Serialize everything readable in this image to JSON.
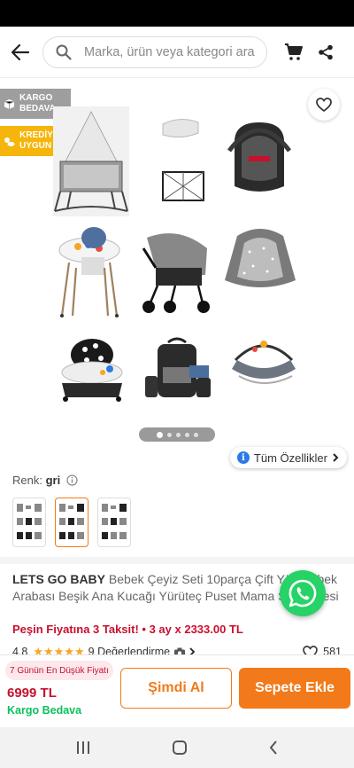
{
  "header": {
    "back_icon": "arrow-left-icon",
    "search_placeholder": "Marka, ürün veya kategori ara",
    "cart_icon": "cart-icon",
    "share_icon": "share-icon"
  },
  "gallery": {
    "badges": [
      {
        "line1": "KARGO",
        "line2": "BEDAVA",
        "color": "#9e9e9e",
        "icon": "box-icon"
      },
      {
        "line1": "KREDİYE",
        "line2": "UYGUN",
        "color": "#f5b50a",
        "icon": "coins-icon"
      }
    ],
    "favorite_icon": "heart-icon",
    "items": [
      "crib",
      "blanket",
      "car-seat",
      "mosquito-net",
      "high-chair",
      "stroller",
      "carrier-cover",
      "baby-walker",
      "diaper-bag",
      "bouncer"
    ],
    "page_dots": 5,
    "active_dot": 0,
    "all_features_label": "Tüm Özellikler"
  },
  "color": {
    "label": "Renk:",
    "value": "gri",
    "selected_index": 1,
    "options_count": 3
  },
  "product": {
    "brand": "LETS GO BABY",
    "title": "Bebek Çeyiz Seti 10parça Çift Yön Bebek Arabası Beşik Ana Kucağı Yürüteç Puset Mama Sandalyesi",
    "installment": "Peşin Fiyatına 3 Taksit! • 3 ay x 2333.00 TL",
    "rating": "4.8",
    "stars": 5,
    "reviews": "9 Değerlendirme",
    "favorites": "581"
  },
  "bottom": {
    "low_price_badge": "7 Günün En Düşük Fiyatı",
    "price": "6999 TL",
    "shipping": "Kargo Bedava",
    "buy_now_label": "Şimdi Al",
    "add_to_cart_label": "Sepete Ekle"
  },
  "colors": {
    "accent": "#f27a1a",
    "price_red": "#c8102e",
    "green": "#0bc15c",
    "whatsapp": "#25d366"
  }
}
